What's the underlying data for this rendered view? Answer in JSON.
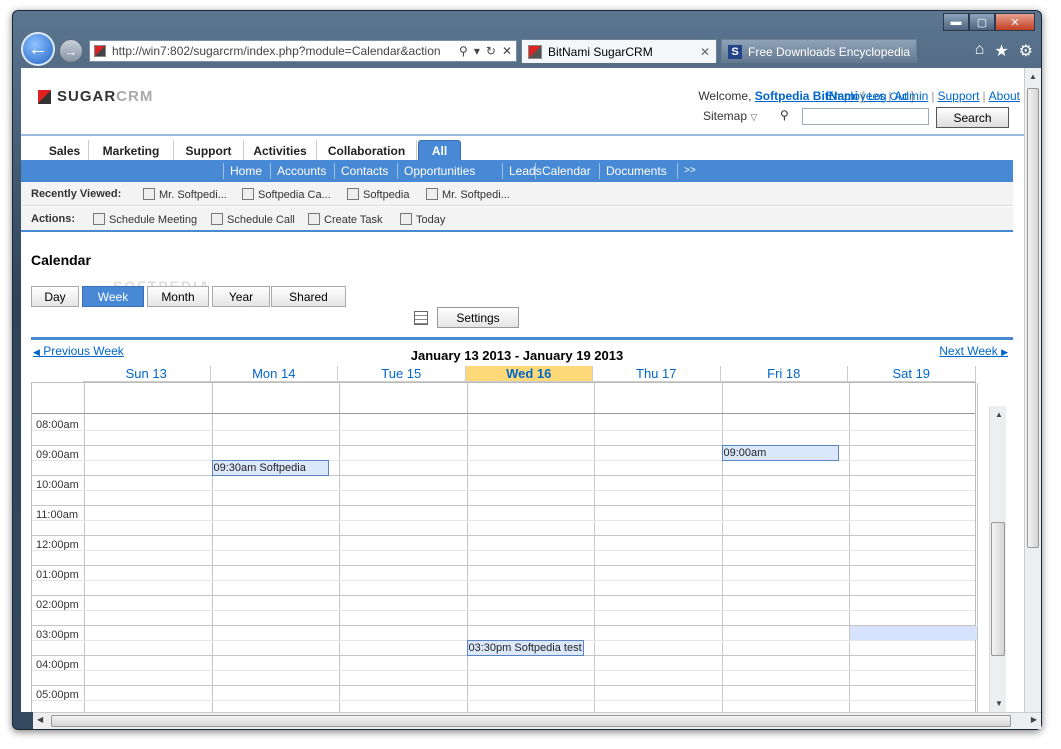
{
  "browser": {
    "url": "http://win7:802/sugarcrm/index.php?module=Calendar&action",
    "tabs": [
      {
        "label": "BitNami SugarCRM",
        "active": true
      },
      {
        "label": "Free Downloads Encyclopedia ...",
        "active": false
      }
    ],
    "window_controls": {
      "minimize": "▬",
      "maximize": "▢",
      "close": "✕"
    },
    "tools": {
      "home": "⌂",
      "favorites": "★",
      "settings": "⚙"
    }
  },
  "header": {
    "logo_main": "SUGAR",
    "logo_sub": "CRM",
    "welcome_prefix": "Welcome,",
    "user_name": "Softpedia BitNami",
    "logout_label": "Log Out",
    "top_links": [
      "Employees",
      "Admin",
      "Support",
      "About"
    ],
    "sitemap_label": "Sitemap",
    "search_button": "Search",
    "search_value": ""
  },
  "module_tabs": [
    "Sales",
    "Marketing",
    "Support",
    "Activities",
    "Collaboration",
    "All"
  ],
  "active_module_tab": "All",
  "sub_nav": [
    "Home",
    "Accounts",
    "Contacts",
    "Opportunities",
    "Leads",
    "Calendar",
    "Documents",
    ">>"
  ],
  "recently_viewed": {
    "label": "Recently Viewed:",
    "items": [
      "Mr. Softpedi...",
      "Softpedia Ca...",
      "Softpedia",
      "Mr. Softpedi..."
    ]
  },
  "actions": {
    "label": "Actions:",
    "items": [
      "Schedule Meeting",
      "Schedule Call",
      "Create Task",
      "Today"
    ]
  },
  "calendar": {
    "title": "Calendar",
    "views": [
      "Day",
      "Week",
      "Month",
      "Year",
      "Shared"
    ],
    "active_view": "Week",
    "settings_label": "Settings",
    "prev_label": "Previous Week",
    "next_label": "Next Week",
    "range": "January 13 2013 - January 19 2013",
    "days": [
      "Sun 13",
      "Mon 14",
      "Tue 15",
      "Wed 16",
      "Thu 17",
      "Fri 18",
      "Sat 19"
    ],
    "today_index": 3,
    "times": [
      "08:00am",
      "09:00am",
      "10:00am",
      "11:00am",
      "12:00pm",
      "01:00pm",
      "02:00pm",
      "03:00pm",
      "04:00pm",
      "05:00pm"
    ],
    "events": [
      {
        "label": "09:30am Softpedia",
        "day": 1
      },
      {
        "label": "09:00am",
        "day": 5
      },
      {
        "label": "03:30pm Softpedia test",
        "day": 3
      }
    ]
  },
  "watermark": "SOFTPEDIA"
}
